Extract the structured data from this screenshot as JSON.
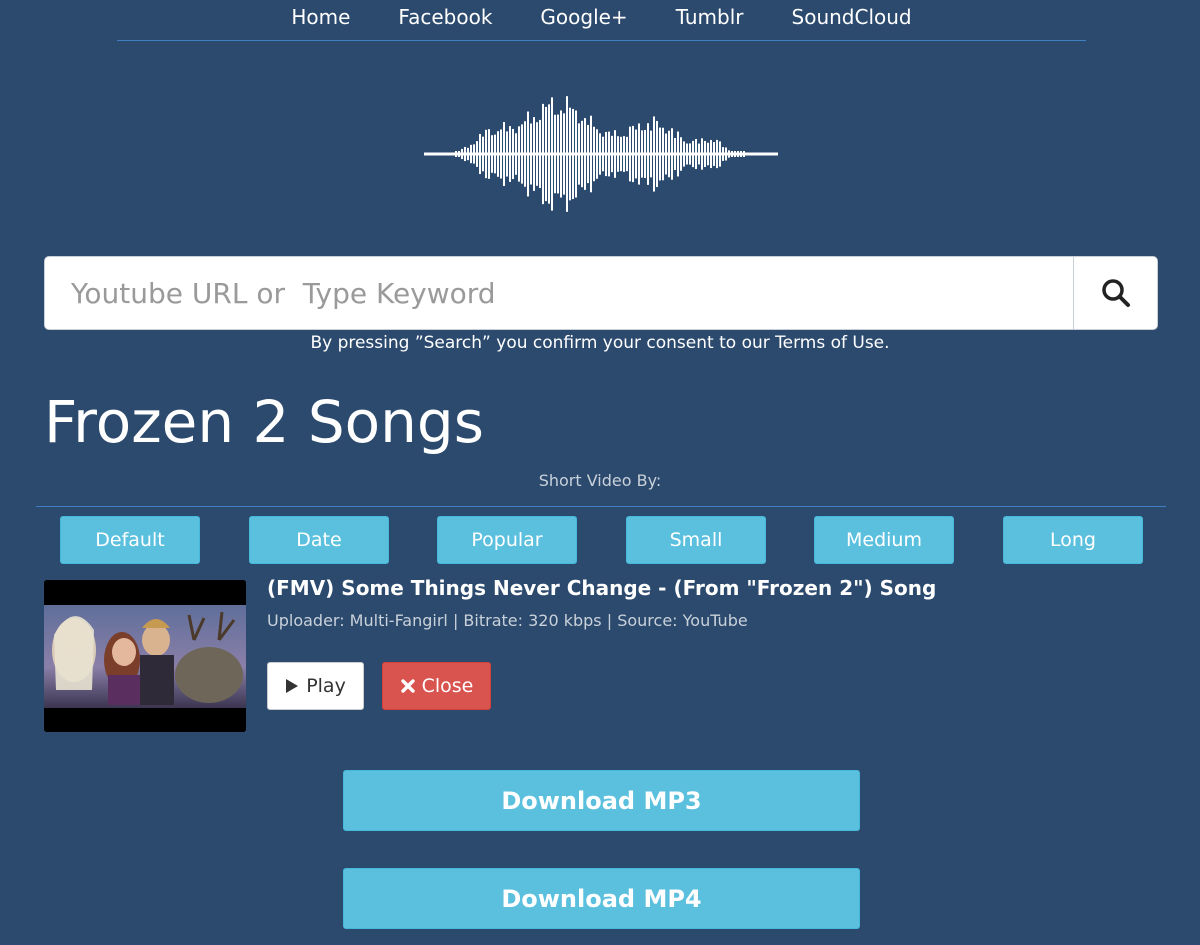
{
  "nav": {
    "items": [
      {
        "label": "Home"
      },
      {
        "label": "Facebook"
      },
      {
        "label": "Google+"
      },
      {
        "label": "Tumblr"
      },
      {
        "label": "SoundCloud"
      }
    ]
  },
  "logo": {
    "icon": "soundwave-icon"
  },
  "search": {
    "placeholder": "Youtube URL or  Type Keyword",
    "value": "",
    "icon": "search-icon",
    "consent": "By pressing ”Search” you confirm your consent to our Terms of Use."
  },
  "page": {
    "title": "Frozen 2 Songs"
  },
  "sort": {
    "label": "Short Video By:",
    "options": [
      {
        "label": "Default"
      },
      {
        "label": "Date"
      },
      {
        "label": "Popular"
      },
      {
        "label": "Small"
      },
      {
        "label": "Medium"
      },
      {
        "label": "Long"
      }
    ]
  },
  "result": {
    "title": "(FMV) Some Things Never Change - (From \"Frozen 2\") Song",
    "meta": "Uploader: Multi-Fangirl | Bitrate: 320 kbps | Source: YouTube",
    "play_label": "Play",
    "play_icon": "play-icon",
    "close_label": "Close",
    "close_icon": "close-icon"
  },
  "downloads": {
    "mp3_label": "Download MP3",
    "mp4_label": "Download MP4"
  },
  "colors": {
    "background": "#2c4a6e",
    "accent": "#5bc0de",
    "danger": "#d9534f",
    "divider": "#3f7fc4"
  }
}
